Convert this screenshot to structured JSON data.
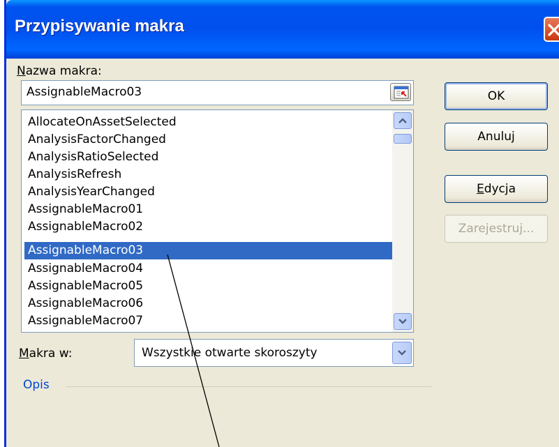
{
  "window": {
    "title": "Przypisywanie makra"
  },
  "macro_name": {
    "label_first": "N",
    "label_rest": "azwa makra:",
    "value": "AssignableMacro03"
  },
  "macro_list": {
    "items": [
      "AllocateOnAssetSelected",
      "AnalysisFactorChanged",
      "AnalysisRatioSelected",
      "AnalysisRefresh",
      "AnalysisYearChanged",
      "AssignableMacro01",
      "AssignableMacro02",
      "AssignableMacro03",
      "AssignableMacro04",
      "AssignableMacro05",
      "AssignableMacro06",
      "AssignableMacro07"
    ],
    "selected_index": 7
  },
  "macros_in": {
    "label_first": "M",
    "label_rest": "akra w:",
    "value": "Wszystkie otwarte skoroszyty"
  },
  "buttons": {
    "ok": "OK",
    "cancel": "Anuluj",
    "edit_first": "E",
    "edit_rest": "dycja",
    "record": "Zarejestruj..."
  },
  "description": {
    "label": "Opis"
  },
  "colors": {
    "title_bar": "#0053ee",
    "selection": "#316ac5",
    "dialog_bg": "#ece9d8",
    "group_label": "#0046d5",
    "close_button": "#c7390d"
  },
  "icons": [
    "close-icon",
    "collapse-dialog-icon",
    "arrow-up-icon",
    "arrow-down-icon"
  ]
}
